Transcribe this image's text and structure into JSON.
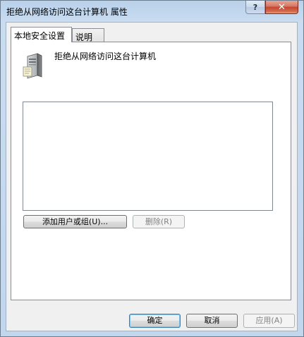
{
  "window": {
    "title": "拒绝从网络访问这台计算机 属性",
    "help_label": "?",
    "close_label": "✕"
  },
  "tabs": [
    {
      "label": "本地安全设置",
      "active": true
    },
    {
      "label": "说明",
      "active": false
    }
  ],
  "policy": {
    "icon": "computer-tower-icon",
    "name": "拒绝从网络访问这台计算机"
  },
  "members_list": {
    "items": []
  },
  "buttons": {
    "add": "添加用户或组(U)...",
    "remove": "删除(R)",
    "ok": "确定",
    "cancel": "取消",
    "apply": "应用(A)"
  },
  "colors": {
    "titlebar": "#c9dcf0",
    "close_button": "#c2462e",
    "dialog_face": "#f0f0f0"
  }
}
